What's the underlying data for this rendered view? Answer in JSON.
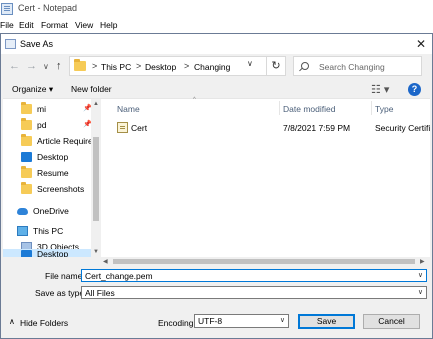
{
  "notepad": {
    "title": "Cert - Notepad",
    "menu": [
      "File",
      "Edit",
      "Format",
      "View",
      "Help"
    ]
  },
  "dialog": {
    "title": "Save As",
    "close_glyph": "✕",
    "nav": {
      "back": "←",
      "forward": "→",
      "dropdown": "∨",
      "up": "↑"
    },
    "breadcrumb": [
      "This PC",
      "Desktop",
      "Changing"
    ],
    "breadcrumb_sep": ">",
    "refresh_glyph": "↻",
    "search_placeholder": "Search Changing",
    "toolbar": {
      "organize": "Organize ▾",
      "new_folder": "New folder",
      "view_glyph": "☷ ▾",
      "help": "?"
    },
    "nav_items": [
      {
        "label": "mi",
        "icon": "folder-icon",
        "pinned": true,
        "selected": false
      },
      {
        "label": "pd",
        "icon": "folder-icon",
        "pinned": true,
        "selected": false
      },
      {
        "label": "Article Requirem",
        "icon": "folder-icon",
        "pinned": false,
        "selected": false
      },
      {
        "label": "Desktop",
        "icon": "desktop-icon",
        "pinned": false,
        "selected": false
      },
      {
        "label": "Resume",
        "icon": "folder-icon",
        "pinned": false,
        "selected": false
      },
      {
        "label": "Screenshots",
        "icon": "folder-icon",
        "pinned": false,
        "selected": false
      },
      {
        "label": "OneDrive",
        "icon": "cloud-icon",
        "pinned": false,
        "selected": false
      },
      {
        "label": "This PC",
        "icon": "computer-icon",
        "pinned": false,
        "selected": false
      },
      {
        "label": "3D Objects",
        "icon": "3d-objects-icon",
        "pinned": false,
        "selected": false
      },
      {
        "label": "Desktop",
        "icon": "desktop-icon",
        "pinned": false,
        "selected": true
      }
    ],
    "pin_glyph": "📌",
    "columns": {
      "name": "Name",
      "date": "Date modified",
      "type": "Type",
      "sort_glyph": "^"
    },
    "files": [
      {
        "name": "Cert",
        "date": "7/8/2021 7:59 PM",
        "type": "Security Certificat",
        "icon": "certificate-icon"
      }
    ],
    "scroll_glyphs": {
      "up": "▲",
      "down": "▼",
      "left": "◀",
      "right": "▶"
    },
    "file_name_label": "File name:",
    "file_name_value": "Cert_change.pem",
    "save_type_label": "Save as type:",
    "save_type_value": "All Files",
    "dropdown_glyph": "∨",
    "hide_folders": "Hide Folders",
    "hide_folders_glyph": "∧",
    "encoding_label": "Encoding:",
    "encoding_value": "UTF-8",
    "save_label": "Save",
    "cancel_label": "Cancel"
  }
}
